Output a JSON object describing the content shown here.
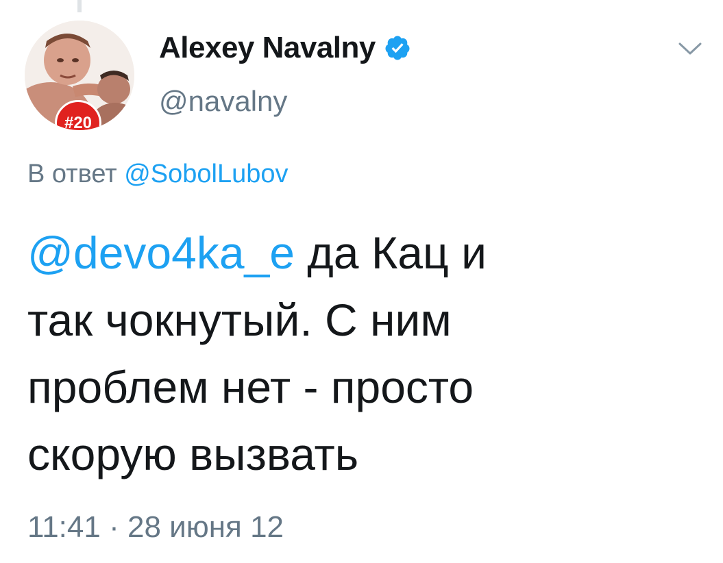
{
  "author": {
    "display_name": "Alexey Navalny",
    "handle": "@navalny",
    "avatar_badge": "#20",
    "verified_icon": "verified-badge-icon"
  },
  "menu": {
    "icon": "chevron-down-icon"
  },
  "reply": {
    "prefix": "В ответ",
    "mention": "@SobolLubov"
  },
  "tweet": {
    "mention": "@devo4ka_e",
    "line1_rest": " да Кац и",
    "line2": "так чокнутый. С ним",
    "line3": "проблем нет - просто",
    "line4": "скорую вызвать"
  },
  "meta": {
    "time": "11:41",
    "separator": "·",
    "date": "28 июня 12"
  },
  "colors": {
    "accent": "#1da1f2",
    "secondary_text": "#657786",
    "badge": "#e0221f"
  }
}
